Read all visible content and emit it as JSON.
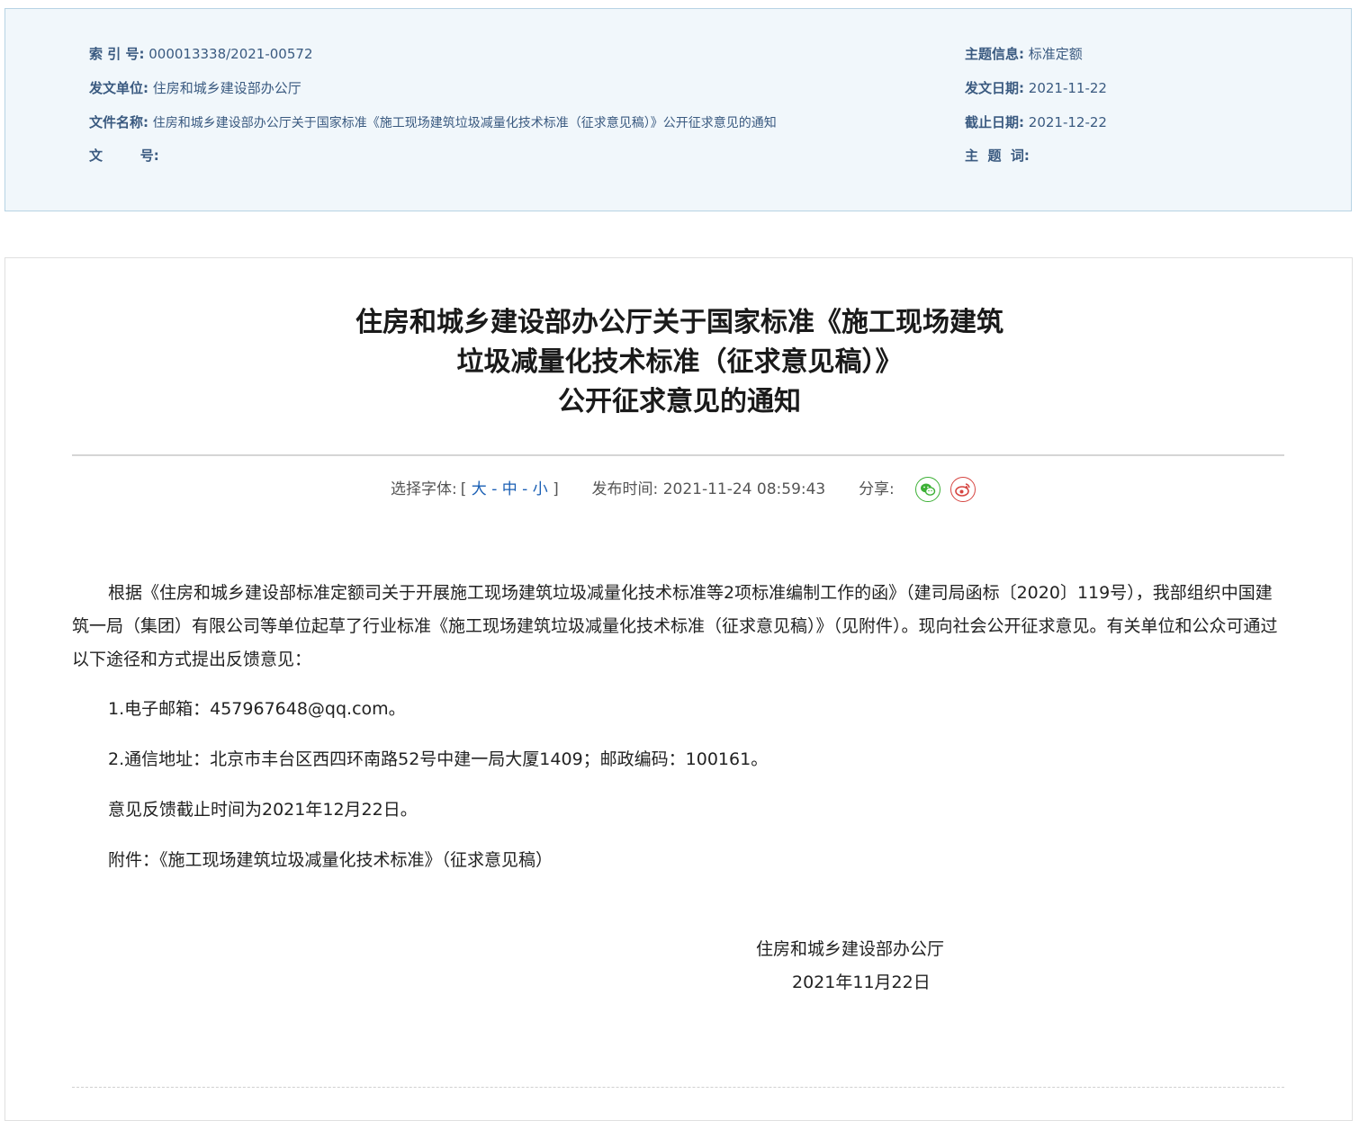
{
  "meta": {
    "index_label": "索  引  号:",
    "index_value": "000013338/2021-00572",
    "issuer_label": "发文单位:",
    "issuer_value": "住房和城乡建设部办公厅",
    "filename_label": "文件名称:",
    "filename_value": "住房和城乡建设部办公厅关于国家标准《施工现场建筑垃圾减量化技术标准（征求意见稿）》公开征求意见的通知",
    "docno_label": "文        号:",
    "docno_value": "",
    "topic_label": "主题信息:",
    "topic_value": "标准定额",
    "date_label": "发文日期:",
    "date_value": "2021-11-22",
    "deadline_label": "截止日期:",
    "deadline_value": "2021-12-22",
    "keywords_label": "主  题  词:",
    "keywords_value": ""
  },
  "article": {
    "title_line1": "住房和城乡建设部办公厅关于国家标准《施工现场建筑",
    "title_line2": "垃圾减量化技术标准（征求意见稿）》",
    "title_line3": "公开征求意见的通知",
    "toolbar": {
      "font_label": "选择字体:",
      "bracket_open": "[",
      "size_large": "大",
      "dash1": "-",
      "size_medium": "中",
      "dash2": "-",
      "size_small": "小",
      "bracket_close": "]",
      "publish_label": "发布时间:",
      "publish_time": "2021-11-24 08:59:43",
      "share_label": "分享:"
    },
    "paragraph1": "根据《住房和城乡建设部标准定额司关于开展施工现场建筑垃圾减量化技术标准等2项标准编制工作的函》（建司局函标〔2020〕119号），我部组织中国建筑一局（集团）有限公司等单位起草了行业标准《施工现场建筑垃圾减量化技术标准（征求意见稿）》（见附件）。现向社会公开征求意见。有关单位和公众可通过以下途径和方式提出反馈意见：",
    "item1": "1.电子邮箱：457967648@qq.com。",
    "item2": "2.通信地址：北京市丰台区西四环南路52号中建一局大厦1409；邮政编码：100161。",
    "deadline_text": "意见反馈截止时间为2021年12月22日。",
    "attachment": "附件：《施工现场建筑垃圾减量化技术标准》（征求意见稿）",
    "signature_org": "住房和城乡建设部办公厅",
    "signature_date": "2021年11月22日"
  },
  "colors": {
    "meta_bg": "#f1f7fb",
    "meta_border": "#b7d3e4",
    "meta_text": "#3a5a80",
    "link": "#1a5fb4",
    "wechat": "#3cb035",
    "weibo": "#d64541"
  },
  "icons": {
    "wechat": "wechat-icon",
    "weibo": "weibo-icon"
  }
}
